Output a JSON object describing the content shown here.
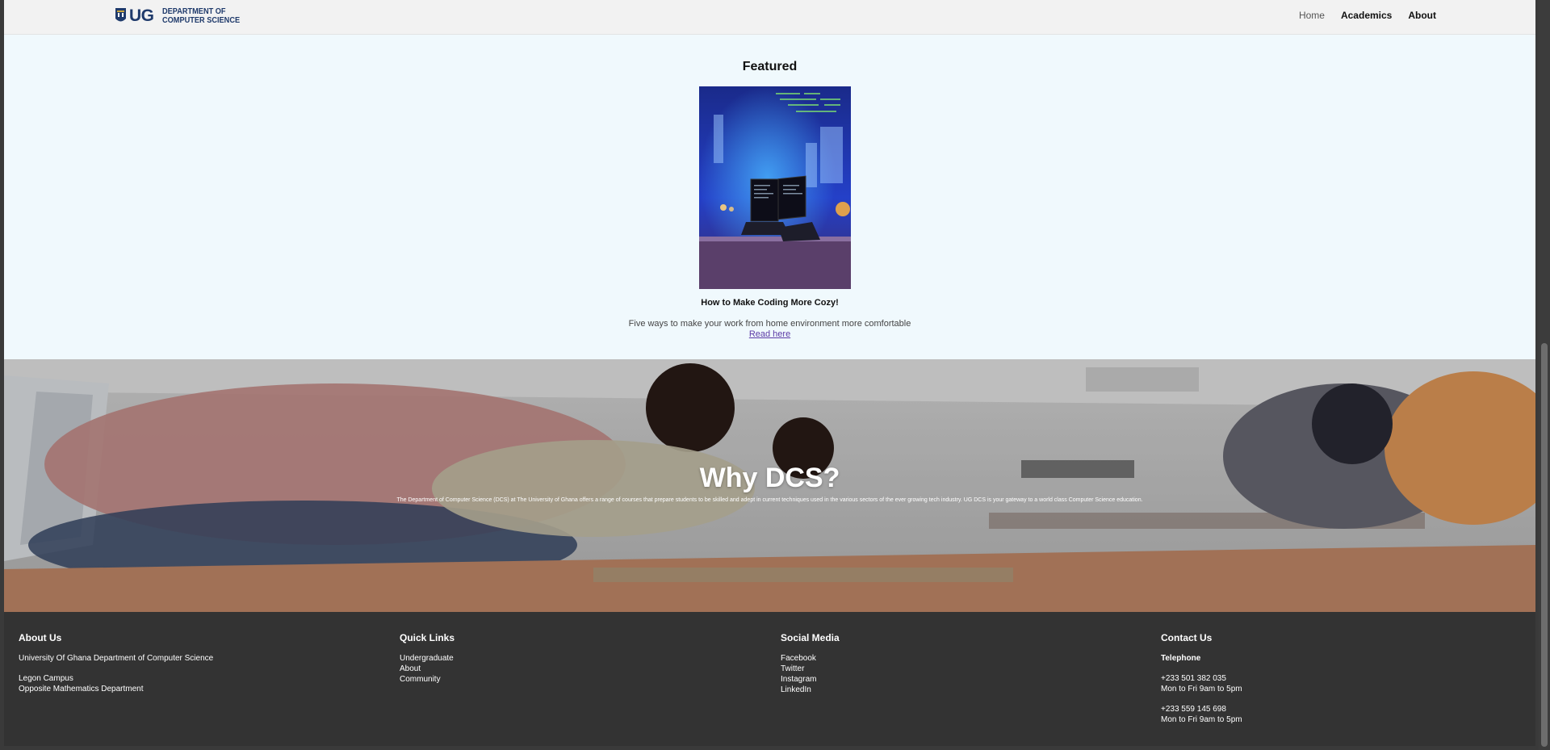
{
  "header": {
    "logo_ug": "UG",
    "logo_line1": "DEPARTMENT OF",
    "logo_line2": "COMPUTER SCIENCE",
    "nav": {
      "home": "Home",
      "academics": "Academics",
      "about": "About"
    }
  },
  "featured": {
    "heading": "Featured",
    "image_alt": "laptops-with-code-icon",
    "post_title": "How to Make Coding More Cozy!",
    "post_desc": "Five ways to make your work from home environment more comfortable",
    "read_more": "Read here"
  },
  "hero": {
    "title": "Why DCS?",
    "text": "The Department of Computer Science (DCS) at The University of Ghana offers a range of courses that prepare students to be skilled and adept in current techniques used in the various sectors of the ever growing tech industry. UG DCS is your gateway to a world class Computer Science education."
  },
  "footer": {
    "about": {
      "heading": "About Us",
      "line1": "University Of Ghana Department of Computer Science",
      "line2": "Legon Campus",
      "line3": "Opposite Mathematics Department"
    },
    "quick_links": {
      "heading": "Quick Links",
      "items": [
        "Undergraduate",
        "About",
        "Community"
      ]
    },
    "social": {
      "heading": "Social Media",
      "items": [
        "Facebook",
        "Twitter",
        "Instagram",
        "LinkedIn"
      ]
    },
    "contact": {
      "heading": "Contact Us",
      "tel_label": "Telephone",
      "phone1": "+233 501 382 035",
      "hours1": "Mon to Fri 9am to 5pm",
      "phone2": "+233 559 145 698",
      "hours2": "Mon to Fri 9am to 5pm"
    }
  },
  "colors": {
    "navbar_bg": "#f2f2f2",
    "page_bg": "#f0f9fd",
    "footer_bg": "#333333",
    "brand": "#1f3a6b",
    "link": "#5b3aa6"
  }
}
